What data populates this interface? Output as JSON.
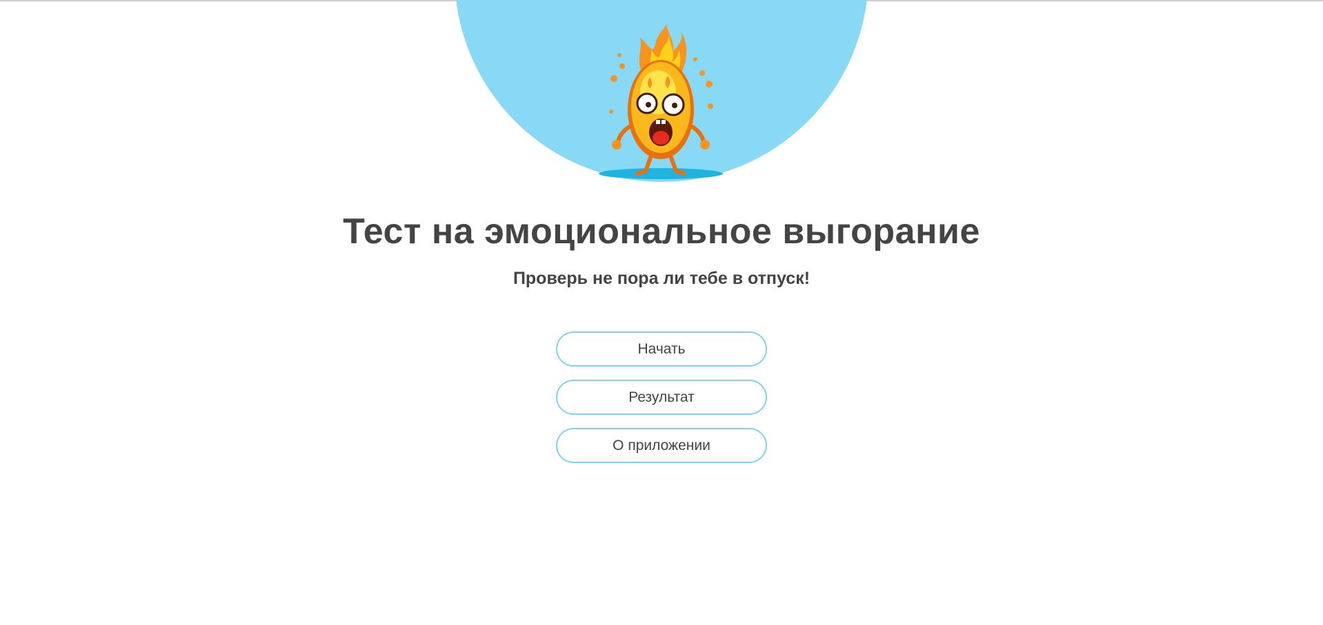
{
  "page": {
    "title": "Тест на эмоциональное выгорание",
    "subtitle": "Проверь не пора ли тебе в отпуск!"
  },
  "hero": {
    "background_color": "#87d9f6",
    "illustration": "burning-flame-character"
  },
  "menu": {
    "buttons": [
      {
        "label": "Начать"
      },
      {
        "label": "Результат"
      },
      {
        "label": "О приложении"
      }
    ],
    "border_color": "#7fd3ef"
  },
  "colors": {
    "text": "#444444",
    "accent": "#87d9f6"
  }
}
